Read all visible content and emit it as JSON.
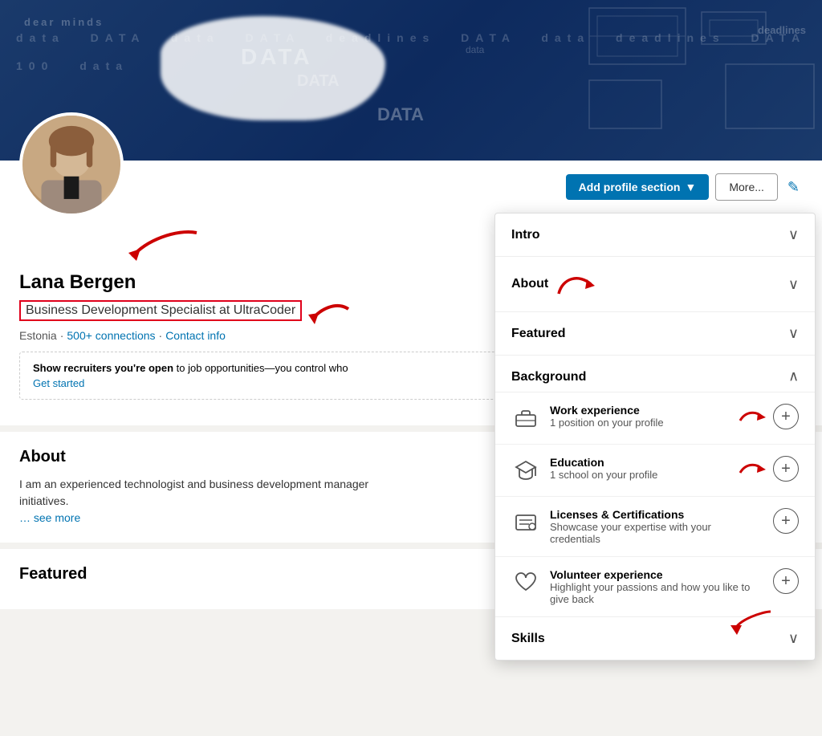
{
  "profile": {
    "name": "Lana Bergen",
    "headline": "Business Development Specialist at UltraCoder",
    "location": "Estonia",
    "connections": "500+ connections",
    "contact_info": "Contact info"
  },
  "recruiter": {
    "text_bold": "Show recruiters you're open",
    "text_normal": " to job opportunities—you control who",
    "get_started": "Get started"
  },
  "about_section": {
    "title": "About",
    "body": "I am an experienced technologist and business development manager",
    "body2": "initiatives.",
    "see_more": "… see more"
  },
  "featured_section": {
    "title": "Featured"
  },
  "buttons": {
    "add_profile_section": "Add profile section",
    "more": "More...",
    "edit_icon": "✎"
  },
  "dropdown": {
    "intro": {
      "label": "Intro"
    },
    "about": {
      "label": "About"
    },
    "featured": {
      "label": "Featured"
    },
    "background": {
      "label": "Background",
      "items": [
        {
          "id": "work",
          "title": "Work experience",
          "subtitle": "1 position on your profile",
          "icon": "briefcase"
        },
        {
          "id": "education",
          "title": "Education",
          "subtitle": "1 school on your profile",
          "icon": "education"
        },
        {
          "id": "licenses",
          "title": "Licenses & Certifications",
          "subtitle": "Showcase your expertise with your credentials",
          "icon": "certificate"
        },
        {
          "id": "volunteer",
          "title": "Volunteer experience",
          "subtitle": "Highlight your passions and how you like to give back",
          "icon": "heart"
        }
      ]
    },
    "skills": {
      "label": "Skills"
    }
  }
}
